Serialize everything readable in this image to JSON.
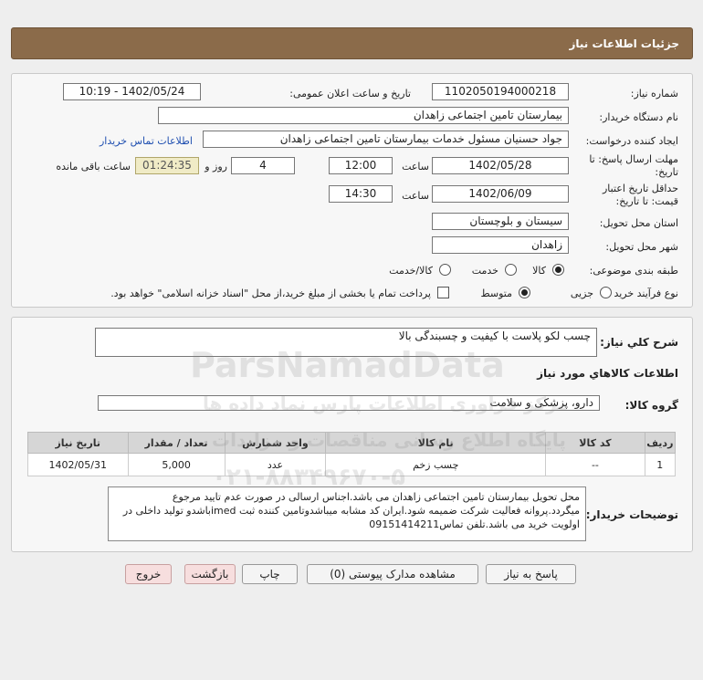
{
  "header": {
    "title": "جزئیات اطلاعات نیاز"
  },
  "form": {
    "need_number_label": "شماره نیاز:",
    "need_number": "1102050194000218",
    "announce_label": "تاریخ و ساعت اعلان عمومی:",
    "announce_value": "1402/05/24 - 10:19",
    "buyer_org_label": "نام دستگاه خریدار:",
    "buyer_org": "بیمارستان تامین اجتماعی زاهدان",
    "creator_label": "ایجاد کننده درخواست:",
    "creator": "جواد حسنیان مسئول خدمات بیمارستان تامین اجتماعی زاهدان",
    "contact_link": "اطلاعات تماس خریدار",
    "deadline_label": "مهلت ارسال پاسخ: تا تاریخ:",
    "deadline_date": "1402/05/28",
    "time_label": "ساعت",
    "deadline_time": "12:00",
    "days_value": "4",
    "days_label": "روز و",
    "remaining_time": "01:24:35",
    "remaining_label": "ساعت باقی مانده",
    "validity_label_1": "حداقل تاریخ اعتبار",
    "validity_label_2": "قیمت: تا تاریخ:",
    "validity_date": "1402/06/09",
    "validity_time": "14:30",
    "province_label": "استان محل تحویل:",
    "province": "سیستان و بلوچستان",
    "city_label": "شهر محل تحویل:",
    "city": "زاهدان",
    "category_label": "طبقه بندی موضوعی:",
    "category_options": [
      "کالا",
      "خدمت",
      "کالا/خدمت"
    ],
    "process_label": "نوع فرآیند خرید :",
    "process_options": [
      "جزیی",
      "متوسط"
    ],
    "payment_note": "پرداخت تمام یا بخشی از مبلغ خرید،از محل \"اسناد خزانه اسلامی\" خواهد بود."
  },
  "details": {
    "summary_label": "شرح کلي نياز:",
    "summary": "چسب لکو پلاست با کیفیت و چسبندگی بالا",
    "items_title": "اطلاعات کالاهاي مورد نياز",
    "group_label": "گروه کالا:",
    "group": "دارو، پزشکی و سلامت",
    "table": {
      "headers": [
        "ردیف",
        "کد کالا",
        "نام کالا",
        "واحد شمارش",
        "تعداد / مقدار",
        "تاریخ نیاز"
      ],
      "rows": [
        [
          "1",
          "--",
          "چسب زخم",
          "عدد",
          "5,000",
          "1402/05/31"
        ]
      ]
    },
    "notes_label": "توضیحات خریدار:",
    "notes": "محل تحویل بیمارستان تامین اجتماعی زاهدان می باشد.اجناس ارسالی در صورت عدم تایید مرجوع میگردد.پروانه فعالیت شرکت ضمیمه شود.ایران کد مشابه میباشدوتامین کننده ثبت imedباشدو تولید داخلی در اولویت خرید می باشد.تلفن تماس09151414211"
  },
  "buttons": {
    "reply": "پاسخ به نیاز",
    "attachments": "مشاهده مدارک پیوستی (0)",
    "print": "چاپ",
    "back": "بازگشت",
    "exit": "خروج"
  },
  "watermark": {
    "brand": "ParsNamadData",
    "line1": "مرکز فراوری اطلاعات پارس نماد داده ها",
    "line2": "پایگاه اطلاع رسانی مناقصات و مزایدات",
    "phone": "۰۲۱-۸۸۳۴۹۶۷۰-۵"
  },
  "colors": {
    "header_bg": "#8b6b4a",
    "link": "#1f4fb0",
    "timer_bg": "#f0ebc6"
  }
}
